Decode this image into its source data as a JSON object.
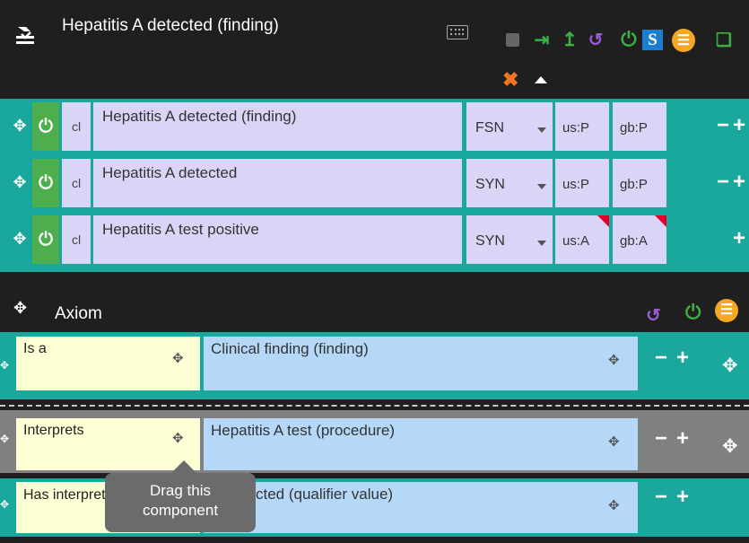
{
  "header": {
    "title": "Hepatitis A detected (finding)",
    "icons": [
      "app-icon",
      "keyboard-icon",
      "save-icon",
      "import-icon",
      "promote-icon",
      "history-icon",
      "power-icon",
      "s-icon",
      "menu-icon",
      "copy-icon",
      "close-icon",
      "caret-up-icon"
    ],
    "colors": {
      "accent_green": "#3cb043",
      "accent_orange": "#f5a623",
      "teal": "#1aa79c",
      "lavender": "#d9d5f7"
    }
  },
  "descriptions": [
    {
      "cl": "cl",
      "term": "Hepatitis A detected (finding)",
      "type": "FSN",
      "us": "us:P",
      "gb": "gb:P",
      "minus": "−",
      "plus": "+"
    },
    {
      "cl": "cl",
      "term": "Hepatitis A detected",
      "type": "SYN",
      "us": "us:P",
      "gb": "gb:P",
      "minus": "−",
      "plus": "+"
    },
    {
      "cl": "cl",
      "term": "Hepatitis A test positive",
      "type": "SYN",
      "us": "us:A",
      "gb": "gb:A",
      "plus": "+"
    }
  ],
  "axiom": {
    "title": "Axiom",
    "relationships": [
      {
        "type": "Is a",
        "target": "Clinical finding (finding)"
      },
      {
        "type": "Interprets",
        "target": "Hepatitis A test (procedure)"
      },
      {
        "type": "Has interpretation",
        "target": "cted (qualifier value)"
      }
    ]
  },
  "tooltip": {
    "line1": "Drag this",
    "line2": "component"
  },
  "controls": {
    "minus": "−",
    "plus": "+"
  }
}
